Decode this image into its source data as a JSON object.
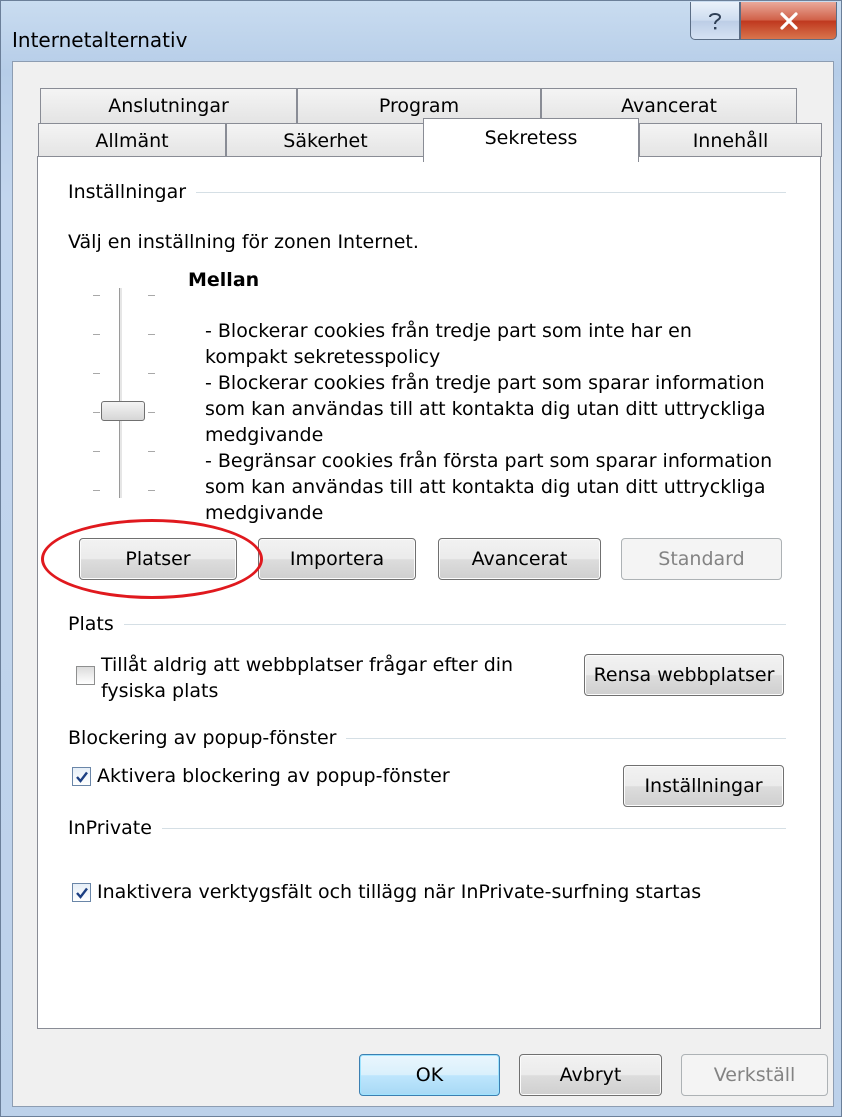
{
  "window": {
    "title": "Internetalternativ",
    "help_symbol": "?",
    "close_symbol": "X"
  },
  "tabs": {
    "row1": [
      "Anslutningar",
      "Program",
      "Avancerat"
    ],
    "row2": [
      "Allmänt",
      "Säkerhet",
      "Sekretess",
      "Innehåll"
    ],
    "active": "Sekretess"
  },
  "settings": {
    "group_label": "Inställningar",
    "zone_text": "Välj en inställning för zonen Internet.",
    "level_name": "Mellan",
    "level_position_of_6": 3,
    "description_lines": [
      "- Blockerar cookies från tredje part som inte har en",
      "kompakt sekretesspolicy",
      "- Blockerar cookies från tredje part som sparar information",
      "som kan användas till att kontakta dig utan ditt uttryckliga",
      "medgivande",
      "- Begränsar cookies från första part som sparar information",
      "som kan användas till att kontakta dig utan ditt uttryckliga",
      "medgivande"
    ],
    "buttons": {
      "sites": "Platser",
      "import": "Importera",
      "advanced": "Avancerat",
      "default": "Standard"
    }
  },
  "location": {
    "group_label": "Plats",
    "checkbox_label_line1": "Tillåt aldrig att webbplatser frågar efter din",
    "checkbox_label_line2": "fysiska plats",
    "checked": false,
    "clear_button": "Rensa webbplatser"
  },
  "popup": {
    "group_label": "Blockering av popup-fönster",
    "checkbox_label": "Aktivera blockering av popup-fönster",
    "checked": true,
    "settings_button": "Inställningar"
  },
  "inprivate": {
    "group_label": "InPrivate",
    "checkbox_label": "Inaktivera verktygsfält och tillägg när InPrivate-surfning startas",
    "checked": true
  },
  "footer": {
    "ok": "OK",
    "cancel": "Avbryt",
    "apply": "Verkställ"
  },
  "colors": {
    "annotation_circle": "#e0191e",
    "close_button": "#c7432a",
    "frame": "#bcd1ea"
  }
}
